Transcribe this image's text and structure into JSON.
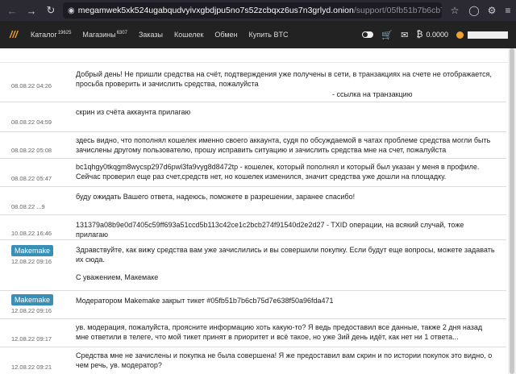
{
  "browser": {
    "url_host": "megamwek5xk524ugabqudvyivxgbdjpu5no7s52zcbqxz6us7n3grlyd.onion",
    "url_path": "/support/05fb51b7b6cb75d7e638f50a"
  },
  "site": {
    "logo": "///",
    "nav": [
      {
        "label": "Каталог",
        "badge": "19625"
      },
      {
        "label": "Магазины",
        "badge": "6307"
      },
      {
        "label": "Заказы",
        "badge": ""
      },
      {
        "label": "Кошелек",
        "badge": ""
      },
      {
        "label": "Обмен",
        "badge": ""
      },
      {
        "label": "Купить BTC",
        "badge": ""
      }
    ],
    "balance": "0.0000"
  },
  "messages": [
    {
      "date": "08.08.22 04:26",
      "tag": "",
      "lines": [
        "Добрый день! Не пришли средства на счёт, подтверждения уже получены в сети, в транзакциях на счете не отображается, просьба проверить и зачислить средства, пожалуйста"
      ],
      "link": "- ссылка на транзакцию"
    },
    {
      "date": "08.08.22 04:59",
      "tag": "",
      "lines": [
        "скрин из счёта аккаунта прилагаю"
      ],
      "link": ""
    },
    {
      "date": "08.08.22 05:08",
      "tag": "",
      "lines": [
        "здесь видно, что пополнял кошелек именно своего аккаунта, судя по обсуждаемой в чатах проблеме средства могли быть зачислены другому пользователю, прошу исправить ситуацию и зачислить средства мне на счет, пожалуйста"
      ],
      "link": ""
    },
    {
      "date": "08.08.22 05:47",
      "tag": "",
      "lines": [
        "bc1qhgy0tkqgm8wycsp297d6pwl3fa9vyg8d8472tp - кошелек, который пополнял и который был указан у меня в профиле. Сейчас проверил еще раз счет,средств нет, но кошелек изменился, значит средства уже дошли на площадку."
      ],
      "link": ""
    },
    {
      "date": "08.08.22 ...9",
      "tag": "",
      "lines": [
        "буду ожидать Вашего ответа, надеюсь, поможете в разрешении, заранее спасибо!"
      ],
      "link": ""
    },
    {
      "date": "10.08.22 16:46",
      "tag": "",
      "lines": [
        "131379a08b9e0d7405c59ff693a51ccd5b113c42ce1c2bcb274f91540d2e2d27 - TXID операции, на всякий случай, тоже прилагаю"
      ],
      "link": ""
    },
    {
      "date": "12.08.22 09:16",
      "tag": "Makemake",
      "lines": [
        "Здравствуйте, как вижу средства вам уже зачислились и вы совершили покупку. Если будут еще вопросы, можете задавать их сюда.",
        "",
        "С уважением, Макемаке"
      ],
      "link": ""
    },
    {
      "date": "12.08.22 09:16",
      "tag": "Makemake",
      "lines": [
        "Модератором Makemake закрыт тикет #05fb51b7b6cb75d7e638f50a96fda471"
      ],
      "link": ""
    },
    {
      "date": "12.08.22 09:17",
      "tag": "",
      "lines": [
        "ув. модерация, пожалуйста, проясните информацию хоть какую-то? Я ведь предоставил все данные, также 2 дня назад мне ответили в телеге, что мой тикет принят в приоритет и всё такое, но уже 3ий день идёт, как нет ни 1 ответа..."
      ],
      "link": ""
    },
    {
      "date": "12.08.22 09:21",
      "tag": "",
      "lines": [
        "Средства мне не зачислены и покупка не была совершена! Я же предоставил вам скрин и по истории покупок это видно, о чем речь, ув. модератор?"
      ],
      "link": ""
    }
  ]
}
